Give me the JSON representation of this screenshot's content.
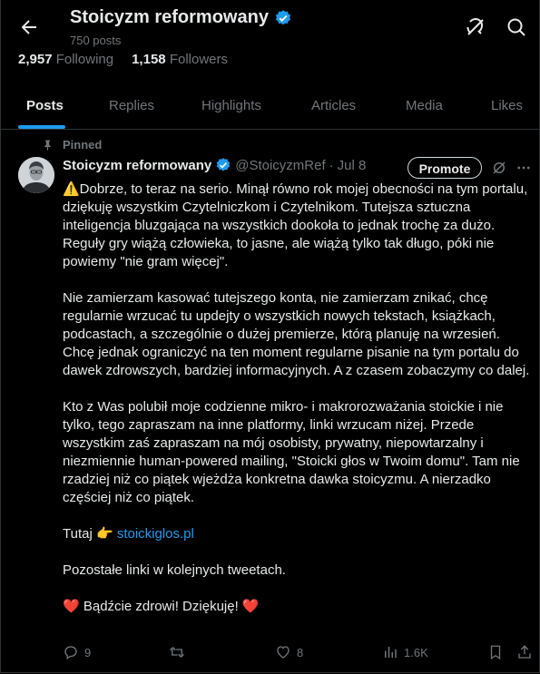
{
  "header": {
    "title": "Stoicyzm reformowany",
    "posts_count": "750 posts",
    "following_count": "2,957",
    "following_label": "Following",
    "followers_count": "1,158",
    "followers_label": "Followers"
  },
  "tabs": [
    "Posts",
    "Replies",
    "Highlights",
    "Articles",
    "Media",
    "Likes"
  ],
  "pinned_label": "Pinned",
  "tweet": {
    "name": "Stoicyzm reformowany",
    "handle": "@StoicyzmRef",
    "dot": "·",
    "date": "Jul 8",
    "promote_label": "Promote",
    "p1": "⚠️Dobrze, to teraz na serio. Minął równo rok mojej obecności na tym portalu, dziękuję wszystkim Czytelniczkom i Czytelnikom. Tutejsza sztuczna inteligencja bluzgająca na wszystkich dookoła to jednak trochę za dużo. Reguły gry wiążą człowieka, to jasne, ale wiążą tylko tak długo, póki nie powiemy \"nie gram więcej\".",
    "p2": "Nie zamierzam kasować tutejszego konta, nie zamierzam znikać, chcę regularnie wrzucać tu updejty o wszystkich nowych tekstach, książkach, podcastach, a szczególnie o dużej premierze, którą planuję na wrzesień. Chcę jednak ograniczyć na ten moment regularne pisanie na tym portalu do dawek zdrowszych, bardziej informacyjnych. A z czasem zobaczymy co dalej.",
    "p3": "Kto z Was polubił moje codzienne mikro- i makrorozważania stoickie i nie tylko, tego zapraszam na inne platformy, linki wrzucam niżej. Przede wszystkim zaś zapraszam na mój osobisty, prywatny, niepowtarzalny i niezmiennie human-powered mailing, \"Stoicki głos w Twoim domu\". Tam nie rzadziej niż co piątek wjeżdża konkretna dawka stoicyzmu. A nierzadko częściej niż co piątek.",
    "link_prefix": "Tutaj 👉 ",
    "link_text": "stoickiglos.pl",
    "p5": "Pozostałe linki w kolejnych tweetach.",
    "p6": "❤️ Bądźcie zdrowi! Dziękuję! ❤️"
  },
  "actions": {
    "replies": "9",
    "retweets": "",
    "likes": "8",
    "views": "1.6K"
  },
  "colors": {
    "background": "#000000",
    "text": "#e7e9ea",
    "muted": "#71767b",
    "accent": "#1d9bf0"
  }
}
